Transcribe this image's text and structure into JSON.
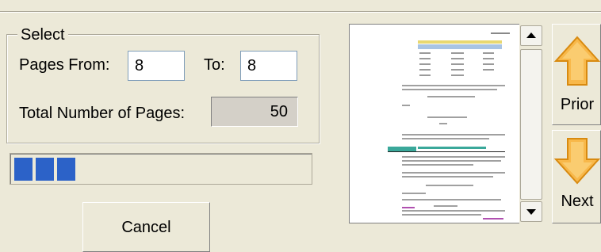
{
  "select": {
    "title": "Select",
    "pages_from_label": "Pages From:",
    "pages_from_value": "8",
    "to_label": "To:",
    "to_value": "8",
    "total_pages_label": "Total Number of Pages:",
    "total_pages_value": "50"
  },
  "progress": {
    "blocks_filled": 3
  },
  "buttons": {
    "cancel": "Cancel",
    "prior": "Prior",
    "next": "Next"
  },
  "colors": {
    "progress_fill": "#2c62c8",
    "arrow_fill": "#f8b84a",
    "arrow_stroke": "#d88a10",
    "preview_header": "#3aa89a"
  },
  "icons": {
    "prior": "up-arrow-icon",
    "next": "down-arrow-icon",
    "scroll_up": "scroll-up-icon",
    "scroll_down": "scroll-down-icon"
  }
}
